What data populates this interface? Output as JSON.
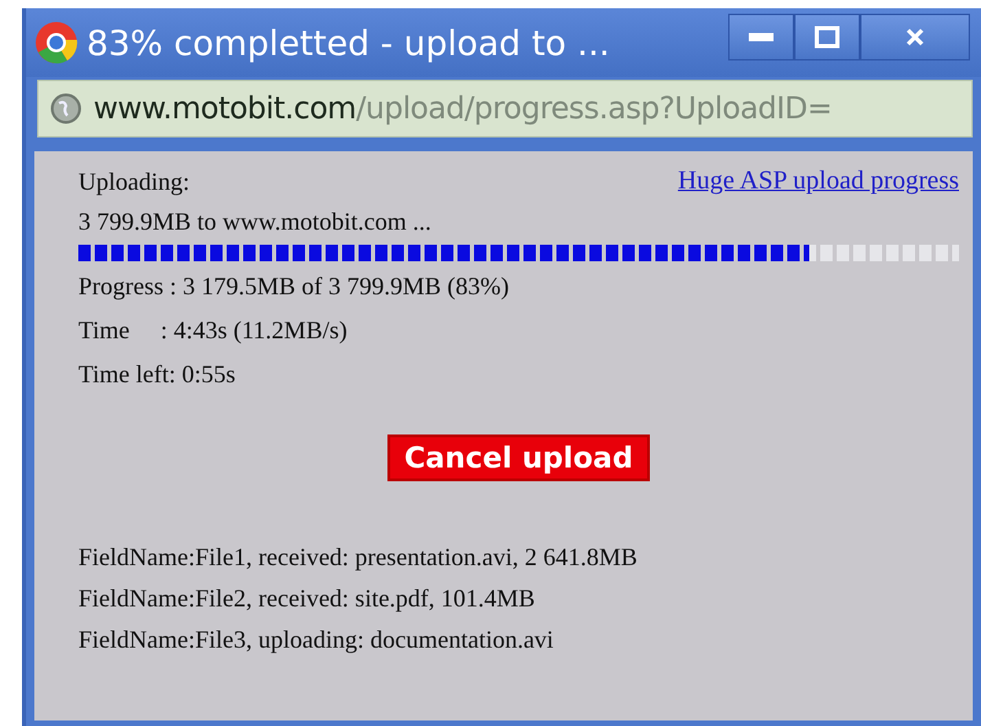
{
  "window": {
    "title": "83% completted - upload to ..."
  },
  "address_bar": {
    "host": "www.motobit.com",
    "path": "/upload/progress.asp?UploadID="
  },
  "upload": {
    "heading": "Uploading:",
    "link": "Huge ASP upload progress",
    "target": "3 799.9MB to www.motobit.com ...",
    "progress": {
      "level": 0.83
    },
    "stats": [
      "Progress : 3 179.5MB of 3 799.9MB (83%)",
      "Time     : 4:43s (11.2MB/s)",
      "Time left: 0:55s"
    ],
    "cancel_button": "Cancel upload",
    "files": [
      "FieldName:File1, received: presentation.avi, 2 641.8MB",
      "FieldName:File2, received: site.pdf, 101.4MB",
      "FieldName:File3, uploading: documentation.avi"
    ]
  }
}
